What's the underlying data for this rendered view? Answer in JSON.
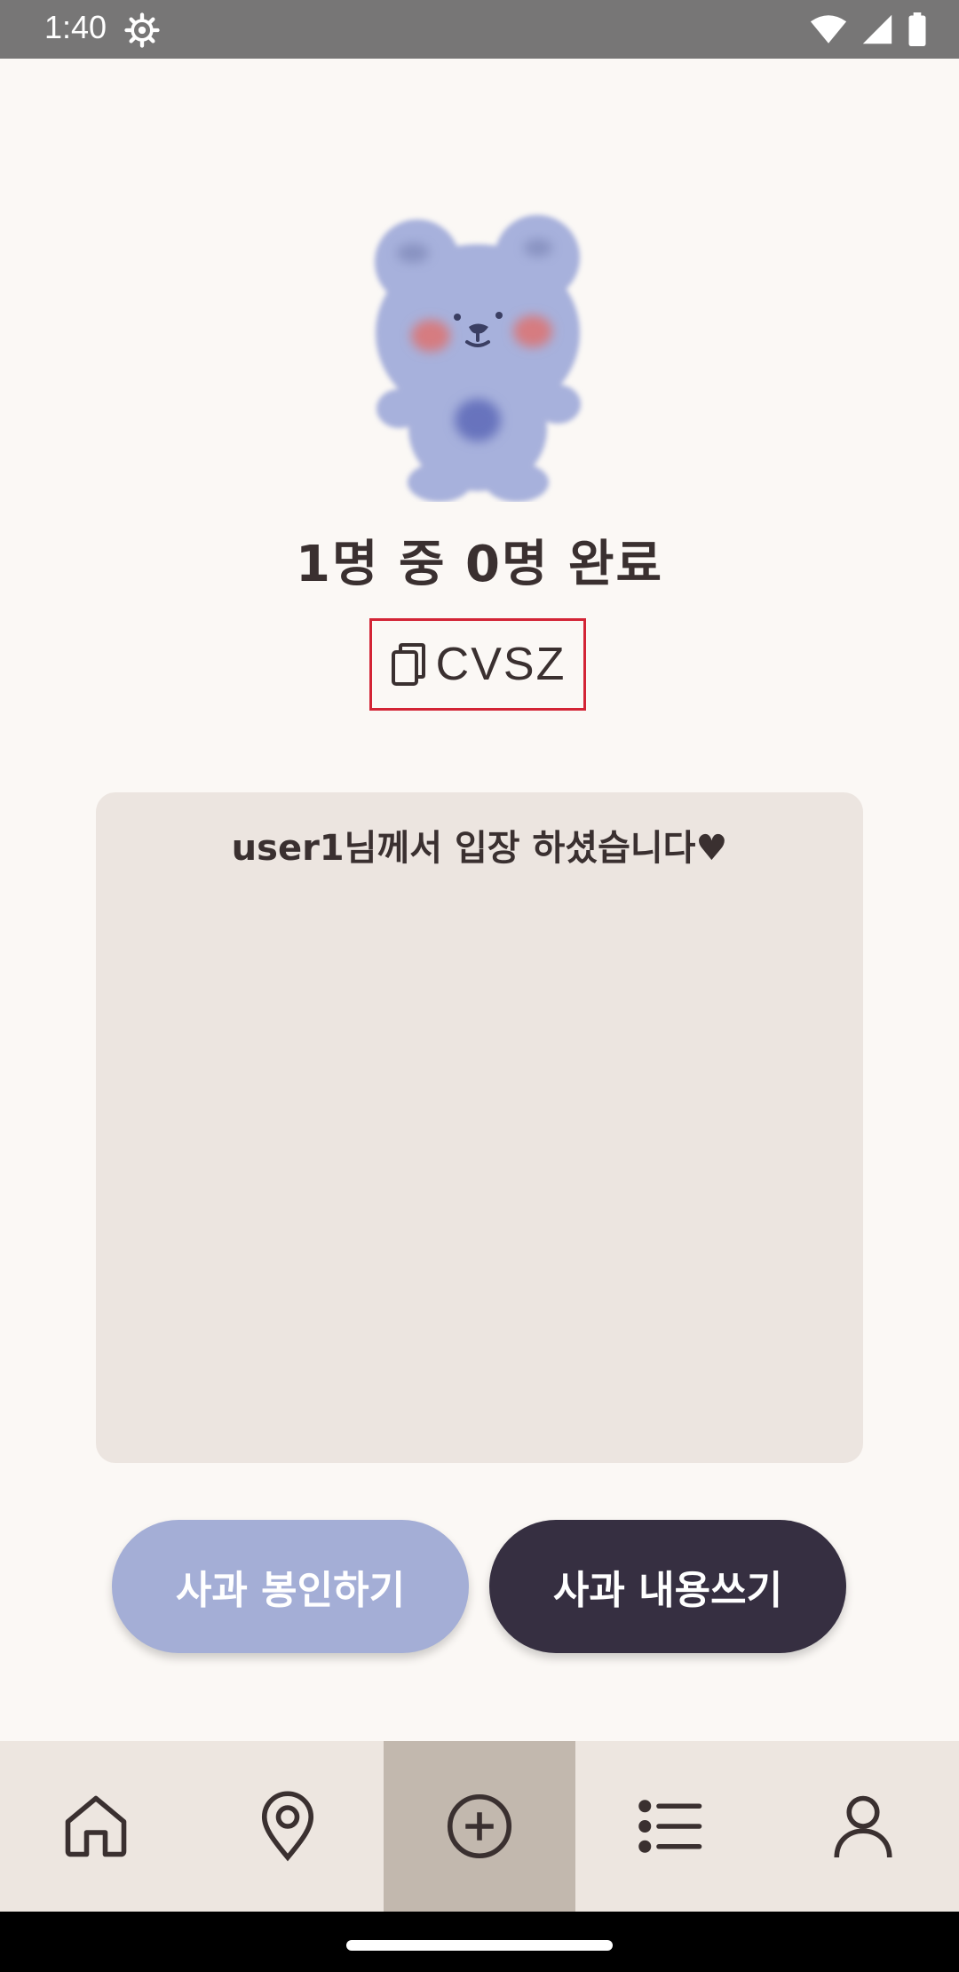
{
  "status_bar": {
    "time": "1:40"
  },
  "room": {
    "progress": "1명 중 0명 완료",
    "code": "CVSZ"
  },
  "log": {
    "messages": [
      "user1님께서 입장 하셨습니다♥"
    ]
  },
  "actions": {
    "seal_label": "사과 봉인하기",
    "write_label": "사과 내용쓰기"
  },
  "bottom_nav": {
    "items": [
      {
        "icon": "home-icon",
        "active": false
      },
      {
        "icon": "location-pin-icon",
        "active": false
      },
      {
        "icon": "add-circle-icon",
        "active": true
      },
      {
        "icon": "list-icon",
        "active": false
      },
      {
        "icon": "profile-icon",
        "active": false
      }
    ]
  },
  "colors": {
    "background": "#fbf8f5",
    "status_bar": "#777676",
    "highlight_border": "#d32435",
    "log_box": "#ece5e0",
    "seal_button": "#a4aed6",
    "write_button": "#362f41",
    "nav_background": "#ede6e0",
    "nav_active": "#c2b8ae",
    "bear": "#a7b1dc"
  }
}
